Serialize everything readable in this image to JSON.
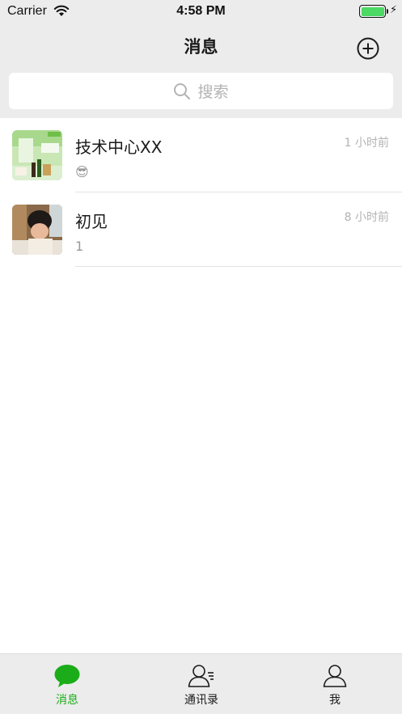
{
  "status_bar": {
    "carrier": "Carrier",
    "time": "4:58 PM",
    "battery_color": "#4cd964"
  },
  "nav": {
    "title": "消息",
    "add_icon": "plus-circle-icon"
  },
  "search": {
    "placeholder": "搜索",
    "icon": "search-icon"
  },
  "chats": [
    {
      "name": "技术中心XX",
      "time": "1 小时前",
      "preview": "😎"
    },
    {
      "name": "初见",
      "time": "8 小时前",
      "preview": "1"
    }
  ],
  "tabs": [
    {
      "label": "消息",
      "icon": "chat-bubble-icon",
      "active": true
    },
    {
      "label": "通讯录",
      "icon": "contacts-icon",
      "active": false
    },
    {
      "label": "我",
      "icon": "person-icon",
      "active": false
    }
  ],
  "colors": {
    "accent": "#1aad19",
    "bar_background": "#ececec",
    "secondary_text": "#b3b3b3"
  }
}
